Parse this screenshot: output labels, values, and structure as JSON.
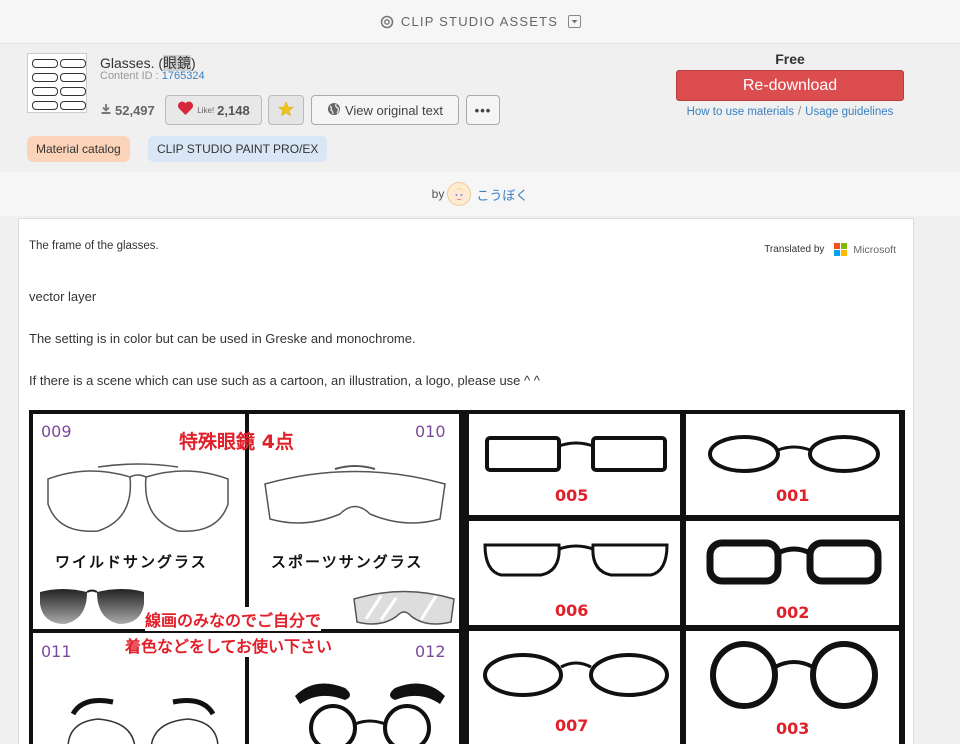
{
  "topbar": {
    "brand": "CLIP STUDIO ASSETS",
    "logo_icon": "clip-studio-logo-icon",
    "menu_icon": "dropdown-square-icon"
  },
  "material": {
    "title_prefix": "Glasses. (",
    "title_highlight": "眼鏡",
    "title_suffix": ")",
    "content_id_label": "Content ID :",
    "content_id": "1765324",
    "downloads": "52,497",
    "like_small": "Like!",
    "likes": "2,148",
    "view_original": "View original text",
    "more": "•••"
  },
  "tags": [
    "Material catalog",
    "CLIP STUDIO PAINT PRO/EX"
  ],
  "purchase": {
    "price": "Free",
    "button": "Re-download",
    "link_how": "How to use materials",
    "separator": "/",
    "link_guidelines": "Usage guidelines"
  },
  "author": {
    "by": "by",
    "name": "こうぼく"
  },
  "description": {
    "title": "The frame of the glasses.",
    "translated_by": "Translated by",
    "translator": "Microsoft",
    "paragraphs": [
      "vector layer",
      "The setting is in color but can be used in Greske and monochrome.",
      "If there is a scene which can use such as a cartoon, an illustration, a logo, please use ^ ^"
    ]
  },
  "sample_image": {
    "special_title": "特殊眼鏡 4点",
    "label_wild": "ワイルドサングラス",
    "label_sports": "スポーツサングラス",
    "note_line1": "線画のみなのでご自分で",
    "note_line2": "着色などをしてお使い下さい",
    "numbers_purple": [
      "009",
      "010",
      "011",
      "012"
    ],
    "numbers_red": [
      "005",
      "001",
      "006",
      "002",
      "007",
      "003"
    ]
  },
  "colors": {
    "accent_red": "#dc4d4f",
    "link_blue": "#3a7fc0",
    "tag_orange": "#fbd3b8",
    "tag_blue": "#d9e6f5"
  }
}
